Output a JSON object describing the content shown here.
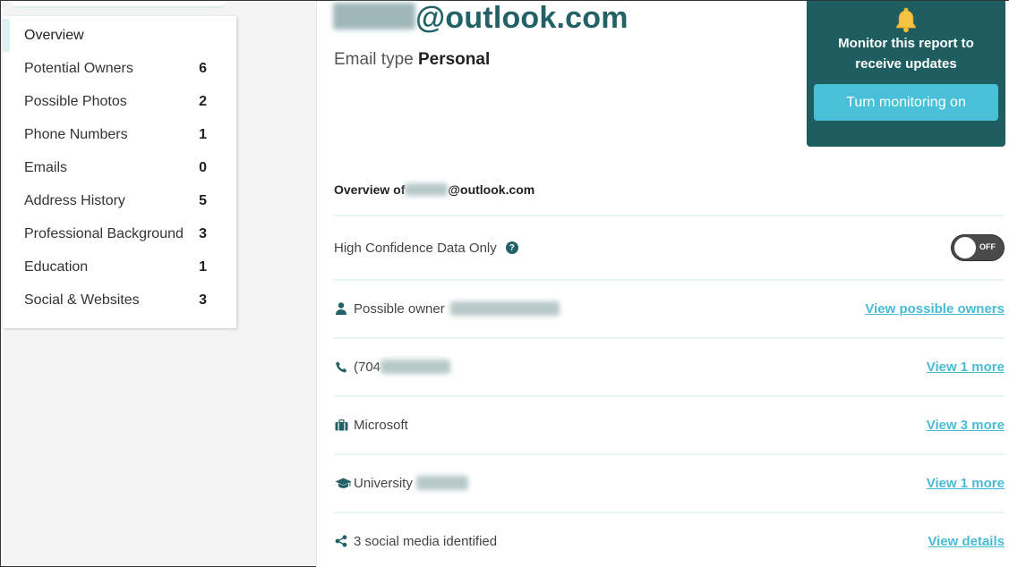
{
  "sidebar": {
    "items": [
      {
        "label": "Overview",
        "count": ""
      },
      {
        "label": "Potential Owners",
        "count": "6"
      },
      {
        "label": "Possible Photos",
        "count": "2"
      },
      {
        "label": "Phone Numbers",
        "count": "1"
      },
      {
        "label": "Emails",
        "count": "0"
      },
      {
        "label": "Address History",
        "count": "5"
      },
      {
        "label": "Professional Background",
        "count": "3"
      },
      {
        "label": "Education",
        "count": "1"
      },
      {
        "label": "Social & Websites",
        "count": "3"
      }
    ]
  },
  "header": {
    "email_redacted": "james",
    "email_domain": "@outlook.com",
    "type_label": "Email type",
    "type_value": "Personal"
  },
  "monitor": {
    "text_line1": "Monitor this report to",
    "text_line2": "receive updates",
    "button_label": "Turn monitoring on"
  },
  "overview": {
    "prefix": "Overview of",
    "domain": "@outlook.com",
    "high_confidence_label": "High Confidence Data Only",
    "toggle_state": "OFF"
  },
  "rows": [
    {
      "icon": "person-icon",
      "text": "Possible owner",
      "link": "View possible owners"
    },
    {
      "icon": "phone-icon",
      "text": "(704",
      "link": "View 1 more"
    },
    {
      "icon": "briefcase-icon",
      "text": "Microsoft",
      "link": "View 3 more"
    },
    {
      "icon": "graduation-cap-icon",
      "text": "University",
      "link": "View 1 more"
    },
    {
      "icon": "share-icon",
      "text": "3 social media identified",
      "link": "View details"
    }
  ],
  "colors": {
    "brand_dark": "#1f5e60",
    "title_teal": "#226266",
    "accent_cyan": "#48bcd4"
  }
}
